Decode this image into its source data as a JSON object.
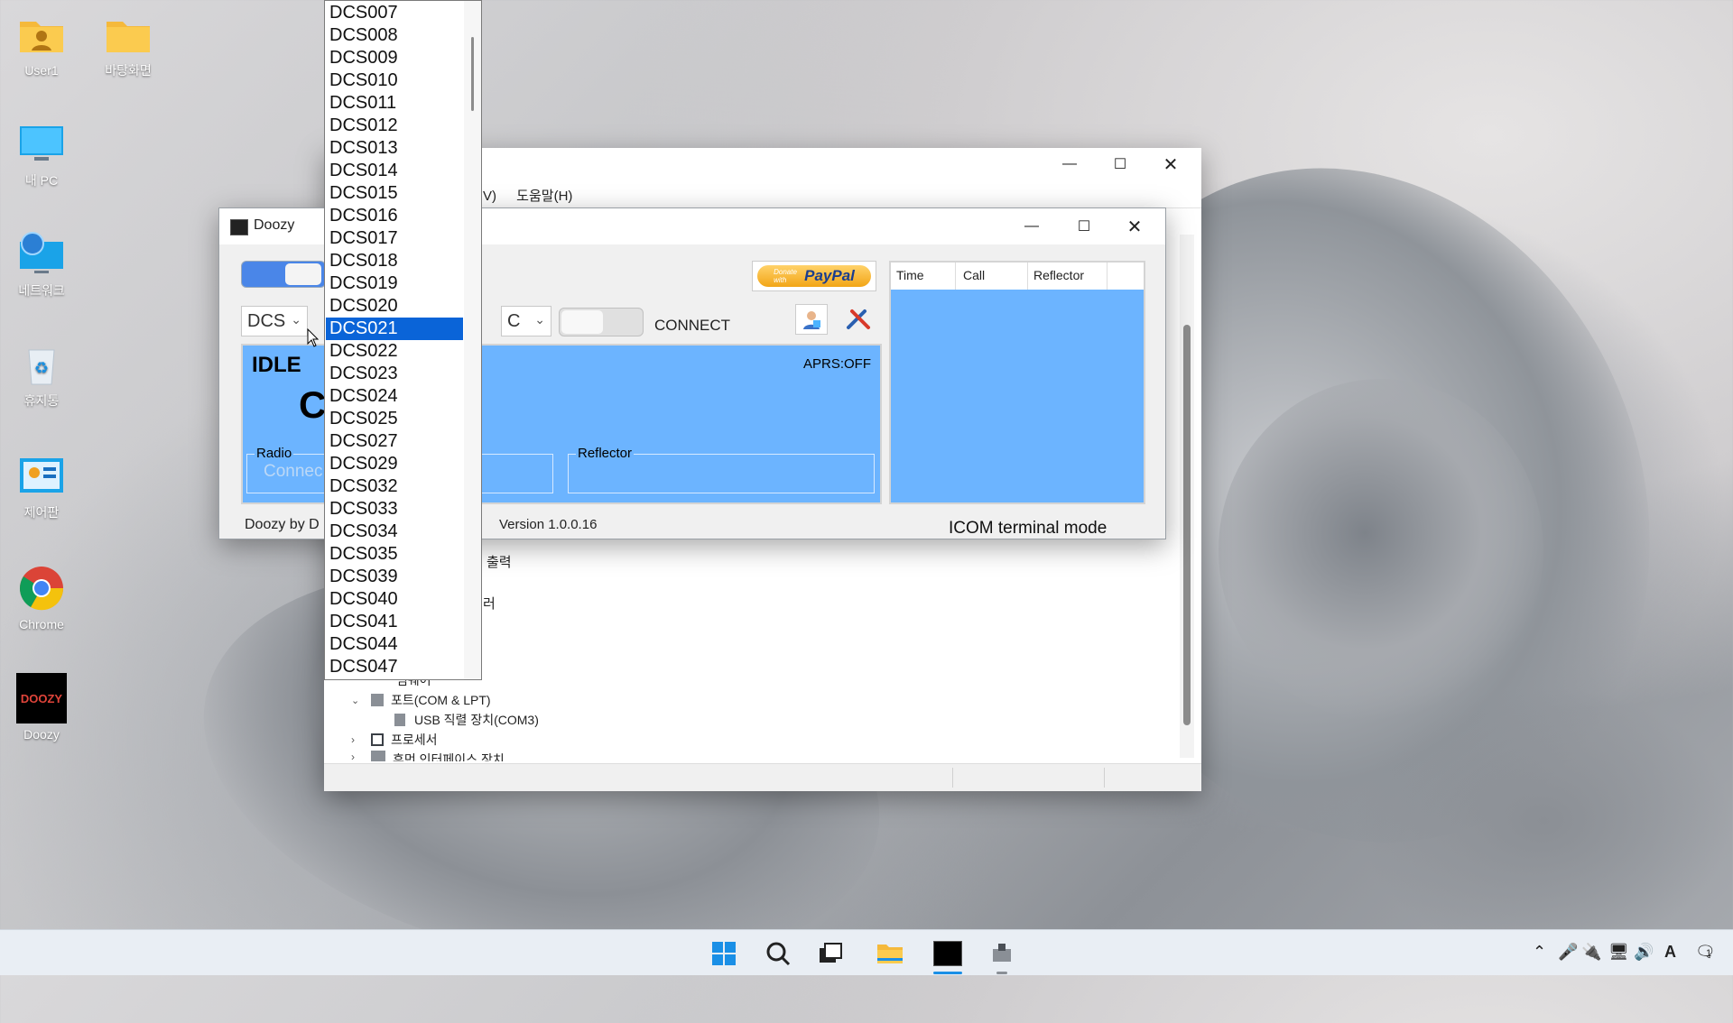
{
  "desktop": {
    "icons": [
      {
        "label": "User1",
        "icon": "user-folder-icon"
      },
      {
        "label": "바탕화면",
        "icon": "folder-icon"
      },
      {
        "label": "내 PC",
        "icon": "monitor-icon"
      },
      {
        "label": "네트워크",
        "icon": "network-icon"
      },
      {
        "label": "휴지통",
        "icon": "recycle-bin-icon"
      },
      {
        "label": "제어판",
        "icon": "control-panel-icon"
      },
      {
        "label": "Chrome",
        "icon": "chrome-icon"
      },
      {
        "label": "Doozy",
        "icon": "doozy-icon"
      }
    ],
    "doozy_logo_text": "DOOZY"
  },
  "device_manager": {
    "menu_partial": "V)",
    "menu_help": "도움말(H)",
    "tree_partial_1": "출력",
    "tree_partial_2": "러",
    "tree_partial_3": "펌웨어",
    "tree_ports": "포트(COM & LPT)",
    "tree_usb": "USB 직렬 장치(COM3)",
    "tree_processor": "프로세서",
    "tree_hid": "휴먼 인터페이스 장치"
  },
  "doozy": {
    "title": "Doozy",
    "mode_select": "DCS",
    "module_select": "C",
    "connect_label": "CONNECT",
    "status": "IDLE",
    "big_letter": "C",
    "aprs": "APRS:OFF",
    "radio_label": "Radio",
    "radio_value": "Connec",
    "reflector_label": "Reflector",
    "footer_left": "Doozy by D",
    "version": "Version 1.0.0.16",
    "terminal_mode": "ICOM terminal mode",
    "paypal_donate": "Donate with",
    "paypal_brand": "PayPal",
    "log_headers": [
      "Time",
      "Call",
      "Reflector"
    ],
    "dropdown_items": [
      "DCS007",
      "DCS008",
      "DCS009",
      "DCS010",
      "DCS011",
      "DCS012",
      "DCS013",
      "DCS014",
      "DCS015",
      "DCS016",
      "DCS017",
      "DCS018",
      "DCS019",
      "DCS020",
      "DCS021",
      "DCS022",
      "DCS023",
      "DCS024",
      "DCS025",
      "DCS027",
      "DCS029",
      "DCS032",
      "DCS033",
      "DCS034",
      "DCS035",
      "DCS039",
      "DCS040",
      "DCS041",
      "DCS044",
      "DCS047"
    ],
    "dropdown_selected": "DCS021"
  },
  "taskbar": {
    "tray_ime": "A",
    "notification_count": "1"
  },
  "colors": {
    "panel_blue": "#6cb4ff",
    "selection_blue": "#0a64d8"
  }
}
